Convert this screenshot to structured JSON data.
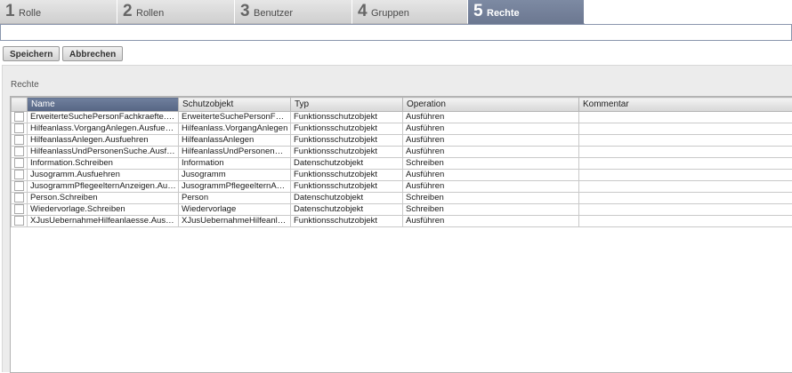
{
  "wizard": {
    "tabs": [
      {
        "num": "1",
        "label": "Rolle"
      },
      {
        "num": "2",
        "label": "Rollen"
      },
      {
        "num": "3",
        "label": "Benutzer"
      },
      {
        "num": "4",
        "label": "Gruppen"
      },
      {
        "num": "5",
        "label": "Rechte"
      }
    ],
    "active_index": 4
  },
  "toolbar": {
    "save_label": "Speichern",
    "cancel_label": "Abbrechen"
  },
  "panel": {
    "title": "Rechte"
  },
  "table": {
    "columns": [
      "Name",
      "Schutzobjekt",
      "Typ",
      "Operation",
      "Kommentar"
    ],
    "sorted_column": "Name",
    "rows": [
      {
        "name": "ErweiterteSuchePersonFachkraefte.Au...",
        "schutzobjekt": "ErweiterteSuchePersonFac...",
        "typ": "Funktionsschutzobjekt",
        "operation": "Ausführen",
        "kommentar": ""
      },
      {
        "name": "Hilfeanlass.VorgangAnlegen.Ausfuehren",
        "schutzobjekt": "Hilfeanlass.VorgangAnlegen",
        "typ": "Funktionsschutzobjekt",
        "operation": "Ausführen",
        "kommentar": ""
      },
      {
        "name": "HilfeanlassAnlegen.Ausfuehren",
        "schutzobjekt": "HilfeanlassAnlegen",
        "typ": "Funktionsschutzobjekt",
        "operation": "Ausführen",
        "kommentar": ""
      },
      {
        "name": "HilfeanlassUndPersonenSuche.Ausfue...",
        "schutzobjekt": "HilfeanlassUndPersonenSu...",
        "typ": "Funktionsschutzobjekt",
        "operation": "Ausführen",
        "kommentar": ""
      },
      {
        "name": "Information.Schreiben",
        "schutzobjekt": "Information",
        "typ": "Datenschutzobjekt",
        "operation": "Schreiben",
        "kommentar": ""
      },
      {
        "name": "Jusogramm.Ausfuehren",
        "schutzobjekt": "Jusogramm",
        "typ": "Funktionsschutzobjekt",
        "operation": "Ausführen",
        "kommentar": ""
      },
      {
        "name": "JusogrammPflegeelternAnzeigen.Ausf...",
        "schutzobjekt": "JusogrammPflegeelternAnz...",
        "typ": "Funktionsschutzobjekt",
        "operation": "Ausführen",
        "kommentar": ""
      },
      {
        "name": "Person.Schreiben",
        "schutzobjekt": "Person",
        "typ": "Datenschutzobjekt",
        "operation": "Schreiben",
        "kommentar": ""
      },
      {
        "name": "Wiedervorlage.Schreiben",
        "schutzobjekt": "Wiedervorlage",
        "typ": "Datenschutzobjekt",
        "operation": "Schreiben",
        "kommentar": ""
      },
      {
        "name": "XJusUebernahmeHilfeanlaesse.Ausfue...",
        "schutzobjekt": "XJusUebernahmeHilfeanlae...",
        "typ": "Funktionsschutzobjekt",
        "operation": "Ausführen",
        "kommentar": ""
      }
    ]
  },
  "colors": {
    "active_tab": "#6c7891",
    "sorted_header": "#566583",
    "inactive_tab": "#d6d6d6"
  }
}
